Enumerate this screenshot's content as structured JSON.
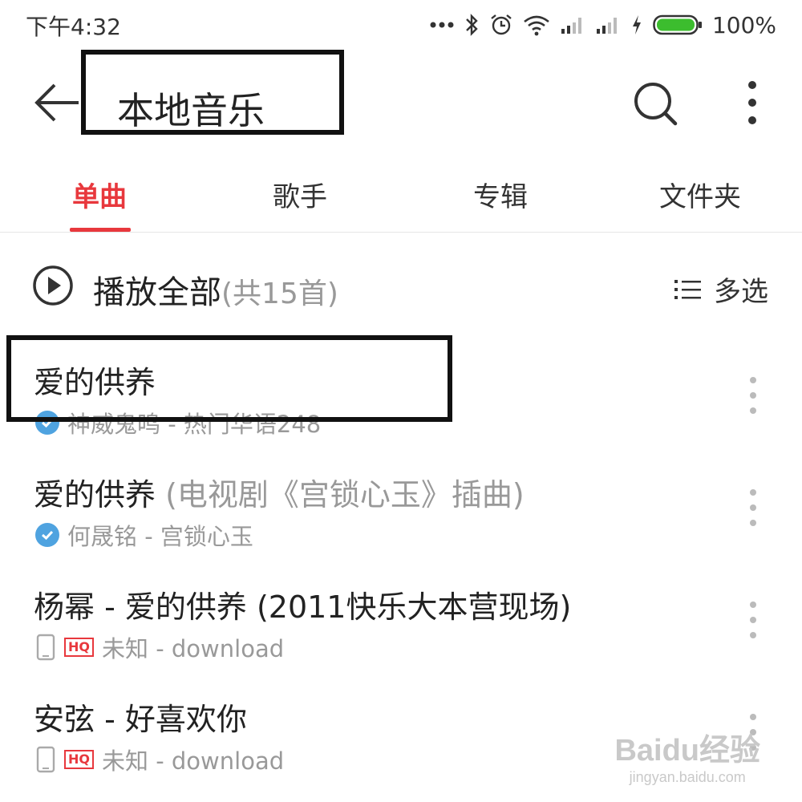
{
  "status_bar": {
    "time": "下午4:32",
    "battery": "100%"
  },
  "header": {
    "title": "本地音乐"
  },
  "tabs": [
    {
      "label": "单曲"
    },
    {
      "label": "歌手"
    },
    {
      "label": "专辑"
    },
    {
      "label": "文件夹"
    }
  ],
  "active_tab": "单曲",
  "play_all": {
    "label": "播放全部",
    "count": "(共15首)",
    "multi_select": "多选"
  },
  "songs": [
    {
      "title": "爱的供养",
      "subtitle": "",
      "meta": "神威鬼鸣 - 热门华语248",
      "source": "cloud"
    },
    {
      "title": "爱的供养 ",
      "subtitle": "(电视剧《宫锁心玉》插曲)",
      "meta": "何晟铭 - 宫锁心玉",
      "source": "cloud"
    },
    {
      "title": "杨幂 - 爱的供养 (2011快乐大本营现场)",
      "subtitle": "",
      "meta": "未知 - download",
      "source": "local",
      "hq_badge": "HQ"
    },
    {
      "title": "安弦 - 好喜欢你",
      "subtitle": "",
      "meta": "未知 - download",
      "source": "local",
      "hq_badge": "HQ"
    }
  ],
  "watermark": {
    "logo": "Baidu经验",
    "url": "jingyan.baidu.com"
  },
  "colors": {
    "accent": "#e8383d",
    "check": "#4fa3e0",
    "muted": "#999999"
  }
}
